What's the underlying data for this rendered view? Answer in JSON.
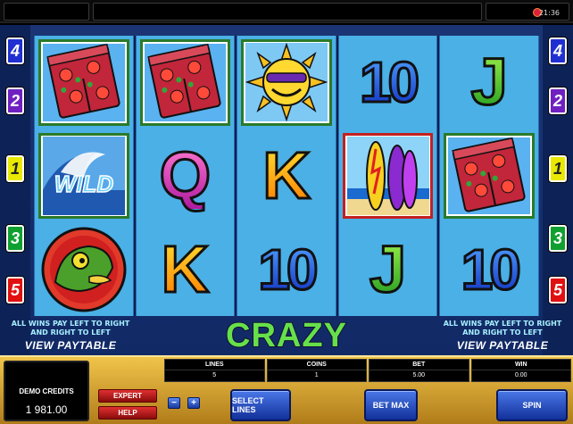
{
  "topbar": {
    "clock": "21:36"
  },
  "paylines": {
    "left": [
      "4",
      "2",
      "1",
      "3",
      "5"
    ],
    "right": [
      "4",
      "2",
      "1",
      "3",
      "5"
    ]
  },
  "reels": [
    [
      "shorts",
      "wild",
      "chameleon"
    ],
    [
      "shorts",
      "Q",
      "K"
    ],
    [
      "sun",
      "K",
      "10"
    ],
    [
      "10",
      "surfboards",
      "J"
    ],
    [
      "J",
      "shorts",
      "10"
    ]
  ],
  "game_title": "CRAZY CHAMELEONS",
  "paytable_note": {
    "line1": "ALL WINS PAY LEFT TO RIGHT",
    "line2": "AND RIGHT TO LEFT",
    "link": "VIEW PAYTABLE"
  },
  "wild_text": "WILD",
  "panel": {
    "credits_label": "DEMO CREDITS",
    "credits_value": "1 981.00",
    "expert": "EXPERT",
    "help": "HELP",
    "minus": "−",
    "plus": "+",
    "meters": [
      {
        "label": "LINES",
        "value": "5"
      },
      {
        "label": "COINS",
        "value": "1"
      },
      {
        "label": "BET",
        "value": "5.00"
      },
      {
        "label": "WIN",
        "value": "0.00"
      }
    ],
    "select_lines": "SELECT LINES",
    "bet_max": "BET MAX",
    "spin": "SPIN"
  },
  "colors": {
    "reel_bg": "#4ab0e6",
    "panel_gold": "#f0c44a",
    "title_green": "#66e04a"
  }
}
